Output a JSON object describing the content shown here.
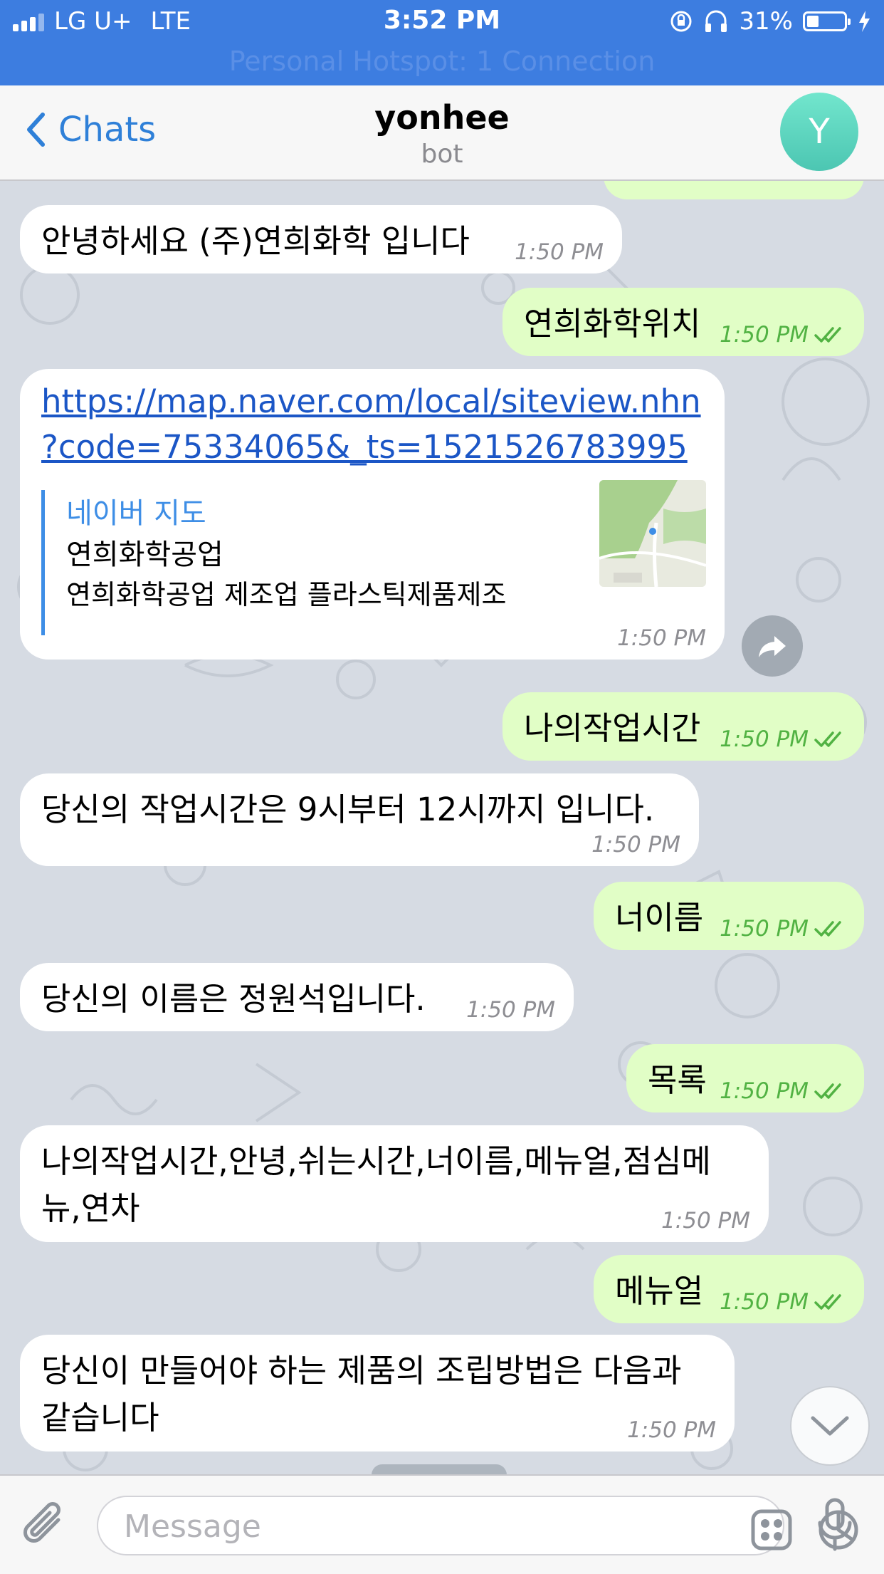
{
  "status_bar": {
    "carrier": "LG U+",
    "network": "LTE",
    "time": "3:52 PM",
    "battery": "31%",
    "battery_level": 0.31,
    "hotspot": "Personal Hotspot: 1 Connection"
  },
  "nav": {
    "back_label": "Chats",
    "title": "yonhee",
    "subtitle": "bot",
    "avatar_letter": "Y"
  },
  "messages": [
    {
      "dir": "in",
      "text": "안녕하세요 (주)연희화학 입니다",
      "time": "1:50 PM"
    },
    {
      "dir": "out",
      "text": "연희화학위치",
      "time": "1:50 PM"
    },
    {
      "dir": "in",
      "link_line1": "https://map.naver.com/local/siteview.nhn",
      "link_line2": "?code=75334065&_ts=1521526783995",
      "preview_site": "네이버 지도",
      "preview_title": "연희화학공업",
      "preview_desc": "연희화학공업 제조업 플라스틱제품제조",
      "time": "1:50 PM"
    },
    {
      "dir": "out",
      "text": "나의작업시간",
      "time": "1:50 PM"
    },
    {
      "dir": "in",
      "text": "당신의 작업시간은 9시부터 12시까지 입니다.",
      "time": "1:50 PM"
    },
    {
      "dir": "out",
      "text": "너이름",
      "time": "1:50 PM"
    },
    {
      "dir": "in",
      "text": "당신의 이름은 정원석입니다.",
      "time": "1:50 PM"
    },
    {
      "dir": "out",
      "text": "목록",
      "time": "1:50 PM"
    },
    {
      "dir": "in",
      "line1": "나의작업시간,안녕,쉬는시간,너이름,메뉴얼,점심메",
      "line2": "뉴,연차",
      "time": "1:50 PM"
    },
    {
      "dir": "out",
      "text": "메뉴얼",
      "time": "1:50 PM"
    },
    {
      "dir": "in",
      "line1": "당신이 만들어야 하는 제품의 조립방법은 다음과",
      "line2": "같습니다",
      "time": "1:50 PM"
    }
  ],
  "composer": {
    "placeholder": "Message"
  },
  "colors": {
    "accent": "#2f80d8",
    "status_bar": "#3d7de0",
    "outgoing_bubble": "#e1fec6",
    "incoming_bubble": "#ffffff",
    "outgoing_time": "#51b243"
  },
  "icons": [
    "chevron-left-icon",
    "share-icon",
    "chevron-down-icon",
    "attach-icon",
    "sticker-icon",
    "clock-icon",
    "mic-icon",
    "double-check-icon"
  ]
}
